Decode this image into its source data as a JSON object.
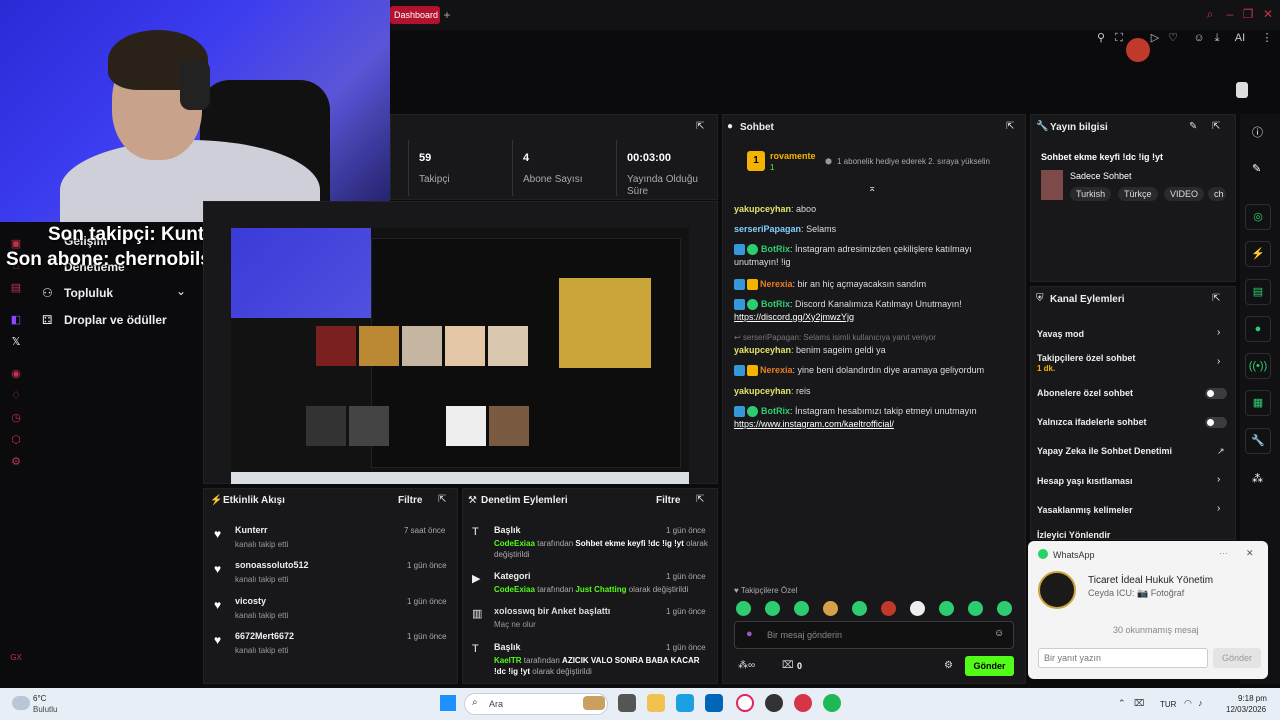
{
  "browser": {
    "tab_label": "Dashboard",
    "new_tab": "+"
  },
  "overlay": {
    "last_follower": "Son takipçi: Kunterr",
    "last_sub": "Son abone: chernobilsefa"
  },
  "nav": {
    "items": [
      "Gelişim",
      "Denetleme",
      "Topluluk",
      "Droplar ve ödüller"
    ]
  },
  "stats": {
    "followers_value": "59",
    "followers_label": "Takipçi",
    "subs_value": "4",
    "subs_label": "Abone Sayısı",
    "uptime_value": "00:03:00",
    "uptime_label": "Yayında Olduğu Süre"
  },
  "chat": {
    "title": "Sohbet",
    "top_user": "rovamente",
    "top_count": "1",
    "gift_notice": "1 abonelik hediye ederek 2. sıraya yükselin",
    "messages": [
      {
        "user": "yakupceyhan",
        "text": "aboo"
      },
      {
        "user": "serseriPapagan",
        "text": "Selams"
      },
      {
        "user": "BotRix",
        "text": "İnstagram adresimizden çekilişlere katılmayı unutmayın! !ig"
      },
      {
        "user": "Nerexia",
        "text": "bir an hiç açmayacaksın sandım"
      },
      {
        "user": "BotRix",
        "text": "Discord Kanalımıza Katılmayı Unutmayın!",
        "link": "https://discord.gg/Xy2jmwzYjg"
      },
      {
        "reply": "serseriPapagan: Selams isimli kullanıcıya yanıt veriyor"
      },
      {
        "user": "yakupceyhan",
        "text": "benim sageim geldi ya"
      },
      {
        "user": "Nerexia",
        "text": "yine beni dolandırdın diye aramaya geliyordum"
      },
      {
        "user": "yakupceyhan",
        "text": "reis"
      },
      {
        "user": "BotRix",
        "text": "İnstagram hesabımızı takip etmeyi unutmayın",
        "link": "https://www.instagram.com/kaeltrofficial/"
      }
    ],
    "followers_only": "Takipçilere Özel",
    "placeholder": "Bir mesaj gönderin",
    "points": "0",
    "send": "Gönder"
  },
  "stream_info": {
    "title": "Yayın bilgisi",
    "stream_title": "Sohbet ekme keyfi !dc !ig !yt",
    "category": "Sadece Sohbet",
    "tags": [
      "Turkish",
      "Türkçe",
      "VIDEO",
      "ch"
    ]
  },
  "channel_actions": {
    "title": "Kanal Eylemleri",
    "slow_mode": "Yavaş mod",
    "followers_chat": "Takipçilere özel sohbet",
    "followers_chat_sub": "1 dk.",
    "subs_chat": "Abonelere özel sohbet",
    "emote_chat": "Yalnızca ifadelerle sohbet",
    "ai_mod": "Yapay Zeka ile Sohbet Denetimi",
    "age_limit": "Hesap yaşı kısıtlaması",
    "banned_words": "Yasaklanmış kelimeler",
    "raid": "İzleyici Yönlendir"
  },
  "activity": {
    "title": "Etkinlik Akışı",
    "filter": "Filtre",
    "items": [
      {
        "name": "Kunterr",
        "sub": "kanalı takip etti",
        "time": "7 saat önce"
      },
      {
        "name": "sonoassoluto512",
        "sub": "kanalı takip etti",
        "time": "1 gün önce"
      },
      {
        "name": "vicosty",
        "sub": "kanalı takip etti",
        "time": "1 gün önce"
      },
      {
        "name": "6672Mert6672",
        "sub": "kanalı takip etti",
        "time": "1 gün önce"
      }
    ]
  },
  "moderation": {
    "title": "Denetim Eylemleri",
    "filter": "Filtre",
    "items": [
      {
        "head": "Başlık",
        "time": "1 gün önce",
        "actor": "CodeExiaa",
        "mid": " tarafından ",
        "value": "Sohbet ekme keyfi !dc !ig !yt",
        "tail": " olarak değiştirildi"
      },
      {
        "head": "Kategori",
        "time": "1 gün önce",
        "actor": "CodeExiaa",
        "mid": " tarafından ",
        "value": "Just Chatting",
        "tail": " olarak değiştirildi"
      },
      {
        "head": "xolosswq bir Anket başlattı",
        "time": "1 gün önce",
        "actor": "",
        "mid": "",
        "value": "",
        "tail": "Maç ne olur"
      },
      {
        "head": "Başlık",
        "time": "1 gün önce",
        "actor": "KaelTR",
        "mid": " tarafından ",
        "value": "AZICIK VALO SONRA BABA KACAR !dc !ig !yt",
        "tail": " olarak değiştirildi"
      }
    ]
  },
  "whatsapp": {
    "app": "WhatsApp",
    "sender": "Ticaret İdeal Hukuk Yönetim",
    "preview": "Ceyda ICU: 📷 Fotoğraf",
    "unread": "30 okunmamış mesaj",
    "reply_placeholder": "Bir yanıt yazın",
    "send": "Gönder"
  },
  "taskbar": {
    "weather_temp": "6°C",
    "weather_desc": "Bulutlu",
    "search": "Ara",
    "lang": "TUR",
    "time": "9:18 pm",
    "date": "12/03/2026"
  },
  "colors": {
    "accent": "#53fc18",
    "brand_red": "#b3122e",
    "panel": "#18181b"
  }
}
